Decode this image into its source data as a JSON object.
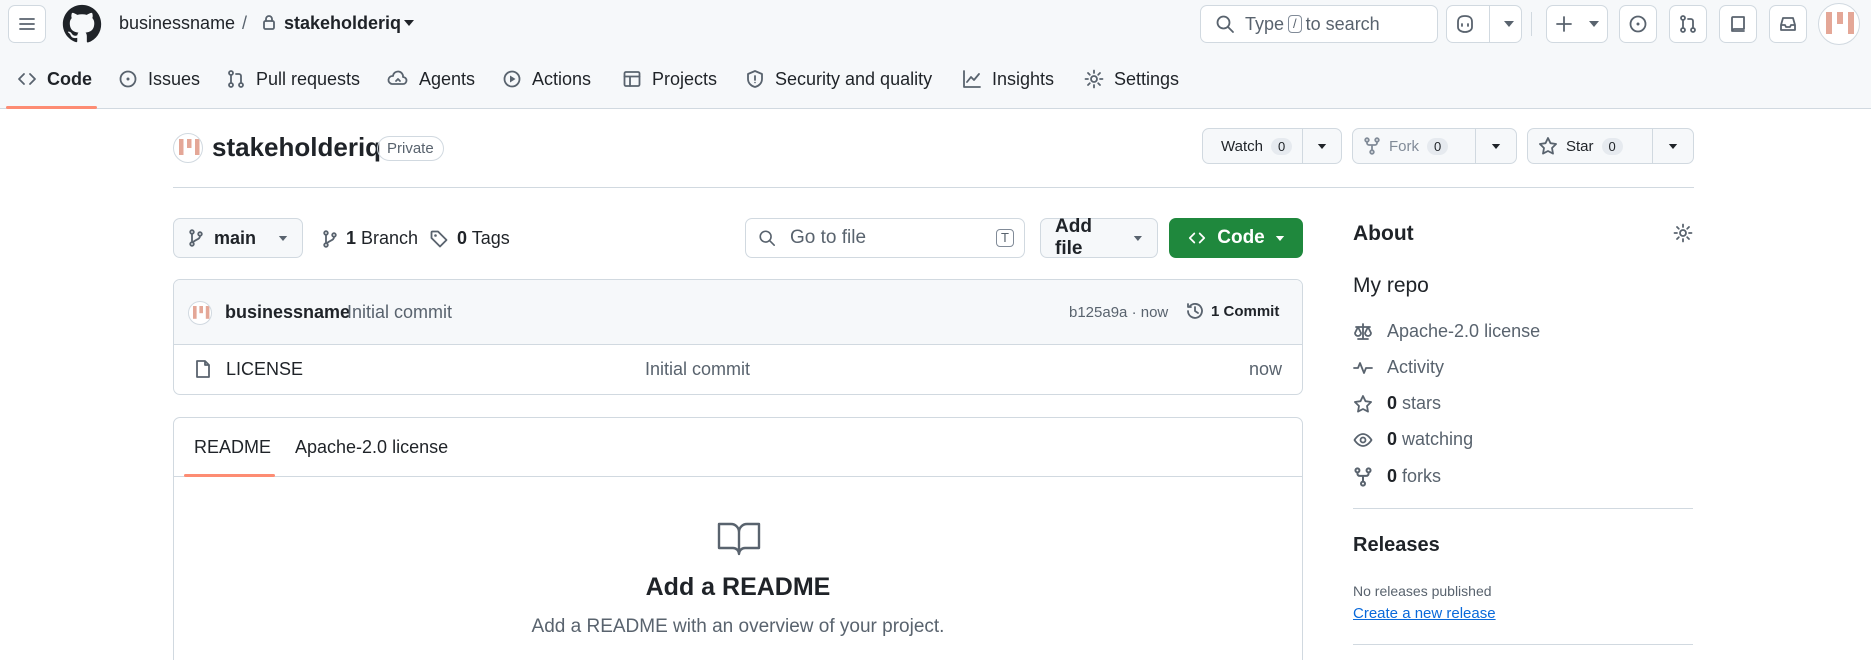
{
  "header": {
    "owner": "businessname",
    "separator": "/",
    "repo": "stakeholderiq",
    "search": {
      "prefix": "Type",
      "key": "/",
      "suffix": "to search"
    }
  },
  "repo_nav": {
    "tabs": [
      {
        "label": "Code",
        "icon": "code-icon",
        "selected": true
      },
      {
        "label": "Issues",
        "icon": "issue-opened-icon"
      },
      {
        "label": "Pull requests",
        "icon": "git-pull-request-icon"
      },
      {
        "label": "Agents",
        "icon": "agent-icon"
      },
      {
        "label": "Actions",
        "icon": "play-icon"
      },
      {
        "label": "Projects",
        "icon": "table-icon"
      },
      {
        "label": "Security and quality",
        "icon": "shield-icon"
      },
      {
        "label": "Insights",
        "icon": "graph-icon"
      },
      {
        "label": "Settings",
        "icon": "gear-icon"
      }
    ]
  },
  "repo_header": {
    "title": "stakeholderiq",
    "visibility": "Private",
    "watch": {
      "label": "Watch",
      "count": "0"
    },
    "fork": {
      "label": "Fork",
      "count": "0"
    },
    "star": {
      "label": "Star",
      "count": "0"
    }
  },
  "file_nav": {
    "branch": "main",
    "branches": {
      "count": "1",
      "label": "Branch"
    },
    "tags": {
      "count": "0",
      "label": "Tags"
    },
    "go_to_file": {
      "placeholder": "Go to file",
      "shortcut": "T"
    },
    "add_file": "Add file",
    "code": "Code"
  },
  "latest_commit": {
    "author": "businessname",
    "message": "Initial commit",
    "sha_time": "b125a9a · now",
    "commits": "1 Commit"
  },
  "files": [
    {
      "name": "LICENSE",
      "message": "Initial commit",
      "time": "now"
    }
  ],
  "readme": {
    "tabs": [
      "README",
      "Apache-2.0 license"
    ],
    "empty_title": "Add a README",
    "empty_text": "Add a README with an overview of your project."
  },
  "about": {
    "heading": "About",
    "description": "My repo",
    "license": "Apache-2.0 license",
    "activity": "Activity",
    "stars": {
      "count": "0",
      "label": "stars"
    },
    "watching": {
      "count": "0",
      "label": "watching"
    },
    "forks": {
      "count": "0",
      "label": "forks"
    }
  },
  "releases": {
    "heading": "Releases",
    "none": "No releases published",
    "create_link": "Create a new release"
  },
  "colors": {
    "accent_green": "#1f883d",
    "tab_underline": "#fd8c73",
    "link": "#0969da",
    "avatar_stripe": "#e4a797"
  }
}
